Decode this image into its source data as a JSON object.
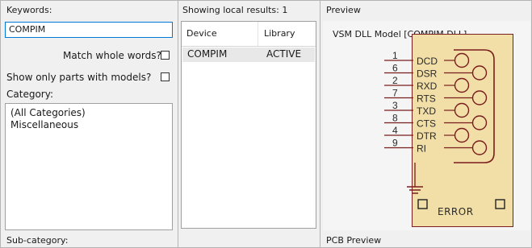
{
  "left_panel": {
    "keywords_label": "Keywords:",
    "keywords_value": "COMPIM",
    "match_whole_words_label": "Match whole words?",
    "match_whole_words_checked": false,
    "show_only_models_label": "Show only parts with models?",
    "show_only_models_checked": false,
    "category_label": "Category:",
    "categories": [
      "(All Categories)",
      "Miscellaneous"
    ],
    "subcategory_label": "Sub-category:"
  },
  "results_panel": {
    "header": "Showing local results: 1",
    "columns": [
      "Device",
      "Library"
    ],
    "rows": [
      {
        "device": "COMPIM",
        "library": "ACTIVE"
      }
    ]
  },
  "preview_panel": {
    "title": "Preview",
    "model_label": "VSM DLL Model [COMPIM.DLL]",
    "pins": [
      {
        "number": "1",
        "name": "DCD"
      },
      {
        "number": "6",
        "name": "DSR"
      },
      {
        "number": "2",
        "name": "RXD"
      },
      {
        "number": "7",
        "name": "RTS"
      },
      {
        "number": "3",
        "name": "TXD"
      },
      {
        "number": "8",
        "name": "CTS"
      },
      {
        "number": "4",
        "name": "DTR"
      },
      {
        "number": "9",
        "name": "RI"
      }
    ],
    "status_text": "ERROR",
    "pcb_preview_label": "PCB Preview",
    "colors": {
      "chip_fill": "#f2dfa8",
      "chip_outline": "#7a1d1d",
      "pin_text": "#2a2a2a"
    }
  }
}
